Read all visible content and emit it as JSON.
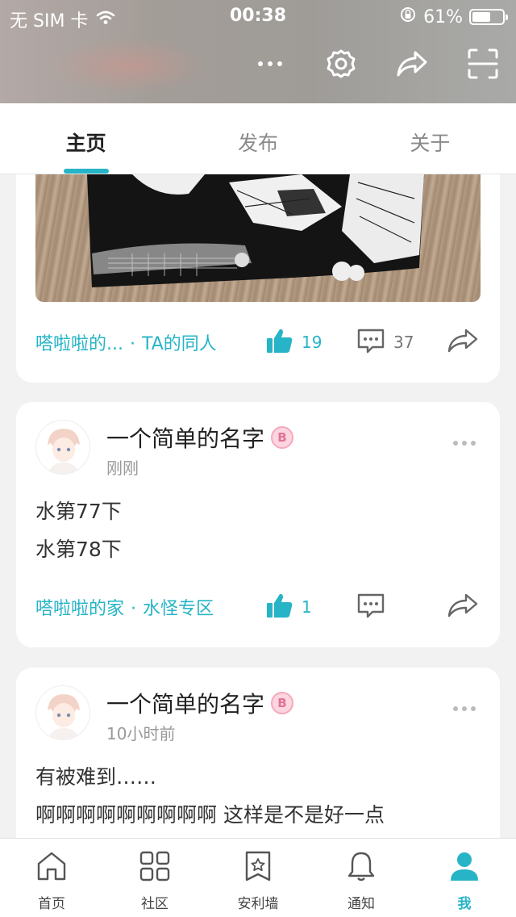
{
  "status_bar": {
    "carrier": "无 SIM 卡",
    "time": "00:38",
    "battery_percent": "61%",
    "battery_level": 0.61
  },
  "header": {
    "actions": [
      "more-icon",
      "gear-icon",
      "share-icon",
      "scan-icon"
    ]
  },
  "tabs": [
    {
      "label": "主页",
      "active": true
    },
    {
      "label": "发布",
      "active": false
    },
    {
      "label": "关于",
      "active": false
    }
  ],
  "posts": [
    {
      "tag_group": "嗒啦啦的...",
      "tag_topic": "TA的同人",
      "likes": "19",
      "comments": "37"
    },
    {
      "author": "一个简单的名字",
      "badge": "B",
      "time": "刚刚",
      "lines": [
        "水第77下",
        "水第78下"
      ],
      "tag_group": "嗒啦啦的家",
      "tag_topic": "水怪专区",
      "likes": "1",
      "comments": ""
    },
    {
      "author": "一个简单的名字",
      "badge": "B",
      "time": "10小时前",
      "lines": [
        "有被难到……",
        "啊啊啊啊啊啊啊啊啊 这样是不是好一点"
      ]
    }
  ],
  "bottom_nav": [
    {
      "label": "首页",
      "icon": "home-icon",
      "active": false
    },
    {
      "label": "社区",
      "icon": "grid-icon",
      "active": false
    },
    {
      "label": "安利墙",
      "icon": "bookmark-star-icon",
      "active": false
    },
    {
      "label": "通知",
      "icon": "bell-icon",
      "active": false
    },
    {
      "label": "我",
      "icon": "user-icon",
      "active": true
    }
  ],
  "colors": {
    "accent": "#26b4c6",
    "background": "#f2f2f2",
    "card": "#ffffff"
  }
}
